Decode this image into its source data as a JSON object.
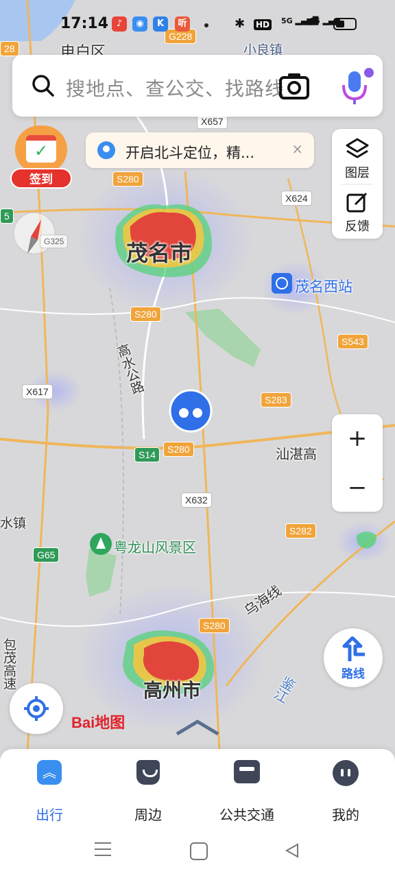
{
  "status_bar": {
    "time": "17:14",
    "network": "5G",
    "network2": "4G"
  },
  "search": {
    "placeholder": "搜地点、查公交、找路线"
  },
  "toast": {
    "text": "开启北斗定位，精...",
    "close": "×"
  },
  "right_panel": {
    "layers_label": "图层",
    "feedback_label": "反馈"
  },
  "zoom": {
    "in": "+",
    "out": "−"
  },
  "checkin": {
    "label": "签到"
  },
  "route_button": {
    "label": "路线"
  },
  "logo": {
    "text": "Bai地图"
  },
  "map": {
    "places": {
      "maoming": "茂名市",
      "gaozhou": "高州市",
      "maoming_west": "茂名西站",
      "dianbai": "电白区",
      "xiaoliang": "小良镇",
      "yuelongshan": "粤龙山风景区",
      "gaoshui_road": "高水公路",
      "shanzhan": "汕湛高",
      "wuhai": "乌海线",
      "jianjiang": "鉴江",
      "baomao": "包茂高速",
      "shuizhen": "水镇"
    },
    "roads": [
      "G228",
      "X657",
      "S280",
      "X624",
      "G325",
      "S280",
      "S543",
      "X617",
      "S283",
      "S14",
      "S280",
      "X632",
      "S282",
      "G65",
      "S280",
      "28",
      "5"
    ]
  },
  "bottom_nav": {
    "items": [
      {
        "label": "出行",
        "active": true
      },
      {
        "label": "周边",
        "active": false
      },
      {
        "label": "公共交通",
        "active": false
      },
      {
        "label": "我的",
        "active": false
      }
    ]
  },
  "colors": {
    "accent": "#2f6fe8",
    "heat_red": "#e2453b",
    "road_orange": "#f0a43a",
    "checkin_red": "#e5322d"
  }
}
